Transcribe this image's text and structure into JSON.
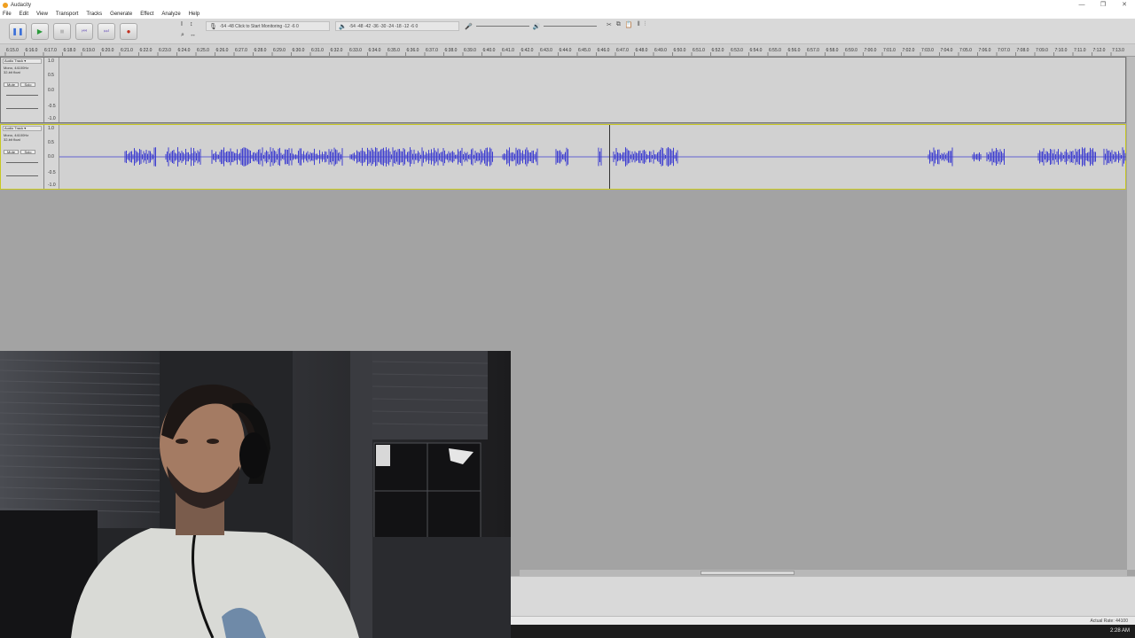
{
  "window": {
    "title": "Audacity",
    "controls": [
      "—",
      "❐",
      "✕"
    ]
  },
  "menu": [
    "File",
    "Edit",
    "View",
    "Transport",
    "Tracks",
    "Generate",
    "Effect",
    "Analyze",
    "Help"
  ],
  "transport": {
    "pause": "❚❚",
    "play": "▶",
    "stop": "■",
    "skip_start": "⏮",
    "skip_end": "⏭",
    "record": "●"
  },
  "meters": {
    "record_scale": "-54  -48  Click to Start Monitoring  -12  -6  0",
    "play_scale": "-54  -48  -42  -36  -30  -24  -18  -12  -6  0"
  },
  "ruler": {
    "ticks": [
      "6:15.0",
      "6:16.0",
      "6:17.0",
      "6:18.0",
      "6:19.0",
      "6:20.0",
      "6:21.0",
      "6:22.0",
      "6:23.0",
      "6:24.0",
      "6:25.0",
      "6:26.0",
      "6:27.0",
      "6:28.0",
      "6:29.0",
      "6:30.0",
      "6:31.0",
      "6:32.0",
      "6:33.0",
      "6:34.0",
      "6:35.0",
      "6:36.0",
      "6:37.0",
      "6:38.0",
      "6:39.0",
      "6:40.0",
      "6:41.0",
      "6:42.0",
      "6:43.0",
      "6:44.0",
      "6:45.0",
      "6:46.0",
      "6:47.0",
      "6:48.0",
      "6:49.0",
      "6:50.0",
      "6:51.0",
      "6:52.0",
      "6:53.0",
      "6:54.0",
      "6:55.0",
      "6:56.0",
      "6:57.0",
      "6:58.0",
      "6:59.0",
      "7:00.0",
      "7:01.0",
      "7:02.0",
      "7:03.0",
      "7:04.0",
      "7:05.0",
      "7:06.0",
      "7:07.0",
      "7:08.0",
      "7:09.0",
      "7:10.0",
      "7:11.0",
      "7:12.0",
      "7:13.0"
    ]
  },
  "tracks": [
    {
      "name": "Audio Track",
      "info": "Mono, 44100Hz\n32-bit float",
      "mute": "Mute",
      "solo": "Solo",
      "scale": [
        "1.0",
        "0.5",
        "0.0",
        "-0.5",
        "-1.0"
      ]
    },
    {
      "name": "Audio Track",
      "info": "Mono, 44100Hz\n32-bit float",
      "mute": "Mute",
      "solo": "Solo",
      "scale": [
        "1.0",
        "0.5",
        "0.0",
        "-0.5",
        "-1.0"
      ]
    }
  ],
  "status": {
    "rate": "Actual Rate: 44100"
  },
  "taskbar": {
    "clock": "2:28 AM"
  },
  "colors": {
    "waveform": "#3f3fd0",
    "selection_border": "#c8c820"
  }
}
